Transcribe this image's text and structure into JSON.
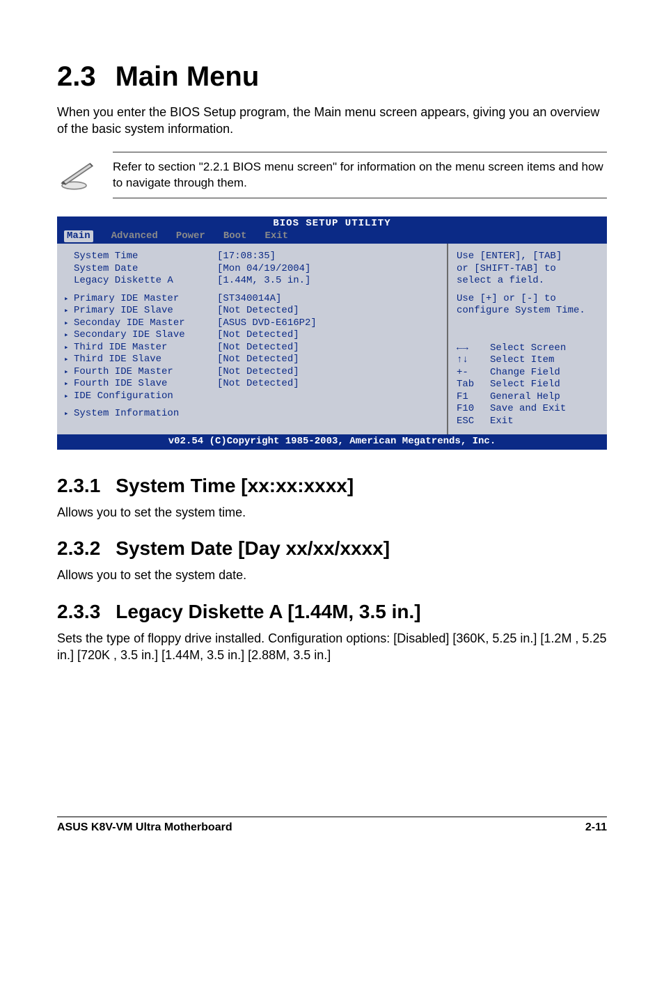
{
  "heading": {
    "num": "2.3",
    "title": "Main Menu"
  },
  "intro": "When you enter the BIOS Setup program, the Main menu screen appears, giving you an overview of the basic system information.",
  "note": "Refer to section \"2.2.1  BIOS menu screen\" for information on the menu screen items and how to navigate through them.",
  "bios": {
    "utility_title": "BIOS SETUP UTILITY",
    "tabs": {
      "main": "Main",
      "advanced": "Advanced",
      "power": "Power",
      "boot": "Boot",
      "exit": "Exit"
    },
    "rows_top": [
      {
        "label": "System Time",
        "value": "[17:08:35]"
      },
      {
        "label": "System Date",
        "value": "[Mon 04/19/2004]"
      },
      {
        "label": "Legacy Diskette A",
        "value": "[1.44M, 3.5 in.]"
      }
    ],
    "rows_sub": [
      {
        "label": "Primary IDE Master",
        "value": "[ST340014A]"
      },
      {
        "label": "Primary IDE Slave",
        "value": "[Not Detected]"
      },
      {
        "label": "Seconday IDE Master",
        "value": "[ASUS DVD-E616P2]"
      },
      {
        "label": "Secondary IDE Slave",
        "value": "[Not Detected]"
      },
      {
        "label": "Third IDE Master",
        "value": "[Not Detected]"
      },
      {
        "label": "Third IDE Slave",
        "value": "[Not Detected]"
      },
      {
        "label": "Fourth IDE Master",
        "value": "[Not Detected]"
      },
      {
        "label": "Fourth IDE Slave",
        "value": "[Not Detected]"
      },
      {
        "label": "IDE Configuration",
        "value": ""
      }
    ],
    "rows_last": [
      {
        "label": "System Information",
        "value": ""
      }
    ],
    "help_top": [
      "Use [ENTER], [TAB]",
      "or [SHIFT-TAB] to",
      "select a field."
    ],
    "help_mid": [
      "Use [+] or [-] to",
      "configure System Time."
    ],
    "keys": [
      {
        "k": "←→",
        "d": "Select Screen"
      },
      {
        "k": "↑↓",
        "d": "Select Item"
      },
      {
        "k": "+-",
        "d": "Change Field"
      },
      {
        "k": "Tab",
        "d": "Select Field"
      },
      {
        "k": "F1",
        "d": "General Help"
      },
      {
        "k": "F10",
        "d": "Save and Exit"
      },
      {
        "k": "ESC",
        "d": "Exit"
      }
    ],
    "bottom": "v02.54 (C)Copyright 1985-2003, American Megatrends, Inc."
  },
  "sections": {
    "s1": {
      "num": "2.3.1",
      "title": "System Time [xx:xx:xxxx]",
      "body": "Allows you to set the system time."
    },
    "s2": {
      "num": "2.3.2",
      "title": "System Date [Day xx/xx/xxxx]",
      "body": "Allows you to set the system date."
    },
    "s3": {
      "num": "2.3.3",
      "title": "Legacy Diskette A [1.44M, 3.5 in.]",
      "body": "Sets the type of floppy drive installed. Configuration options: [Disabled] [360K, 5.25 in.] [1.2M , 5.25 in.] [720K , 3.5 in.] [1.44M, 3.5 in.] [2.88M, 3.5 in.]"
    }
  },
  "footer": {
    "left": "ASUS K8V-VM Ultra Motherboard",
    "right": "2-11"
  }
}
